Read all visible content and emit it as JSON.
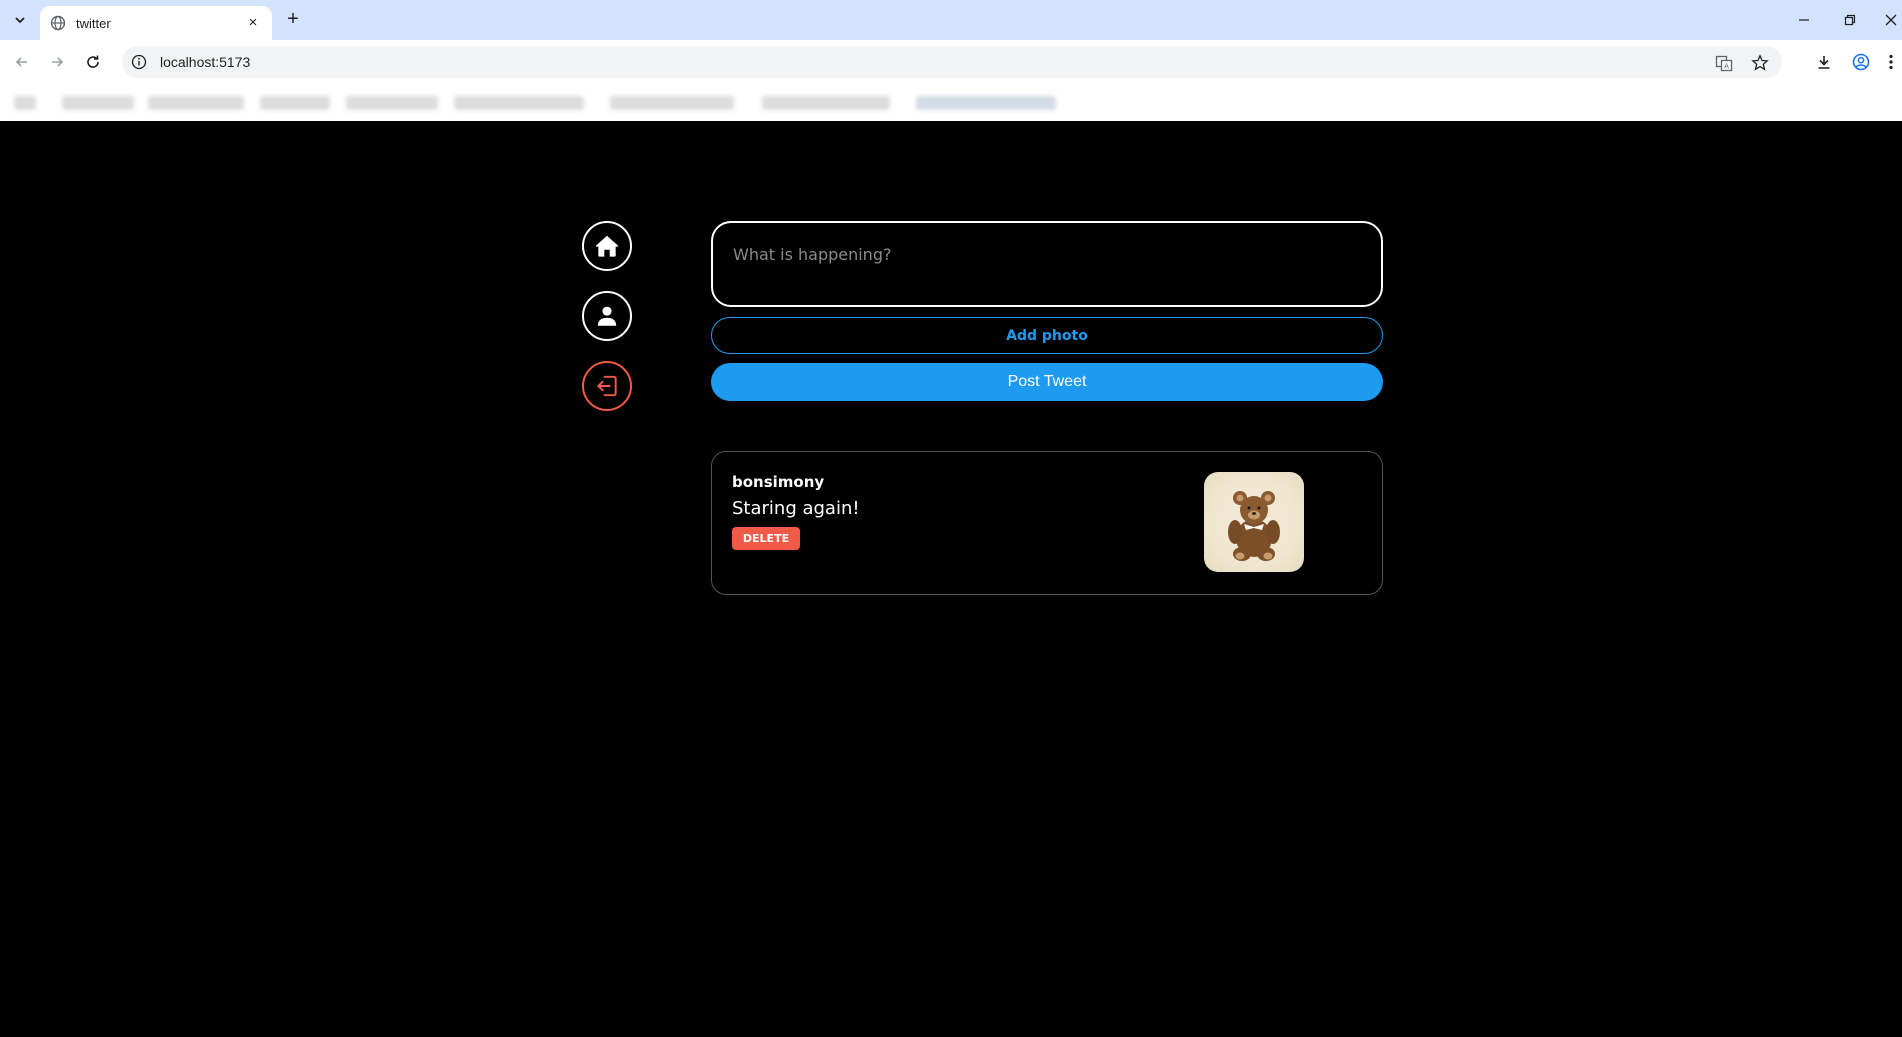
{
  "browser": {
    "tab_title": "twitter",
    "url": "localhost:5173",
    "new_tab_symbol": "+",
    "close_tab_symbol": "×"
  },
  "composer": {
    "placeholder": "What is happening?",
    "add_photo_label": "Add photo",
    "post_label": "Post Tweet"
  },
  "tweets": [
    {
      "username": "bonsimony",
      "text": "Staring again!",
      "delete_label": "DELETE",
      "photo_alt": "teddy bear"
    }
  ],
  "colors": {
    "background": "#000000",
    "accent": "#1d9bf0",
    "danger": "#f05a46",
    "tabstrip": "#d3e3fd"
  },
  "icons": {
    "nav": [
      "home-icon",
      "user-icon",
      "logout-icon"
    ]
  }
}
